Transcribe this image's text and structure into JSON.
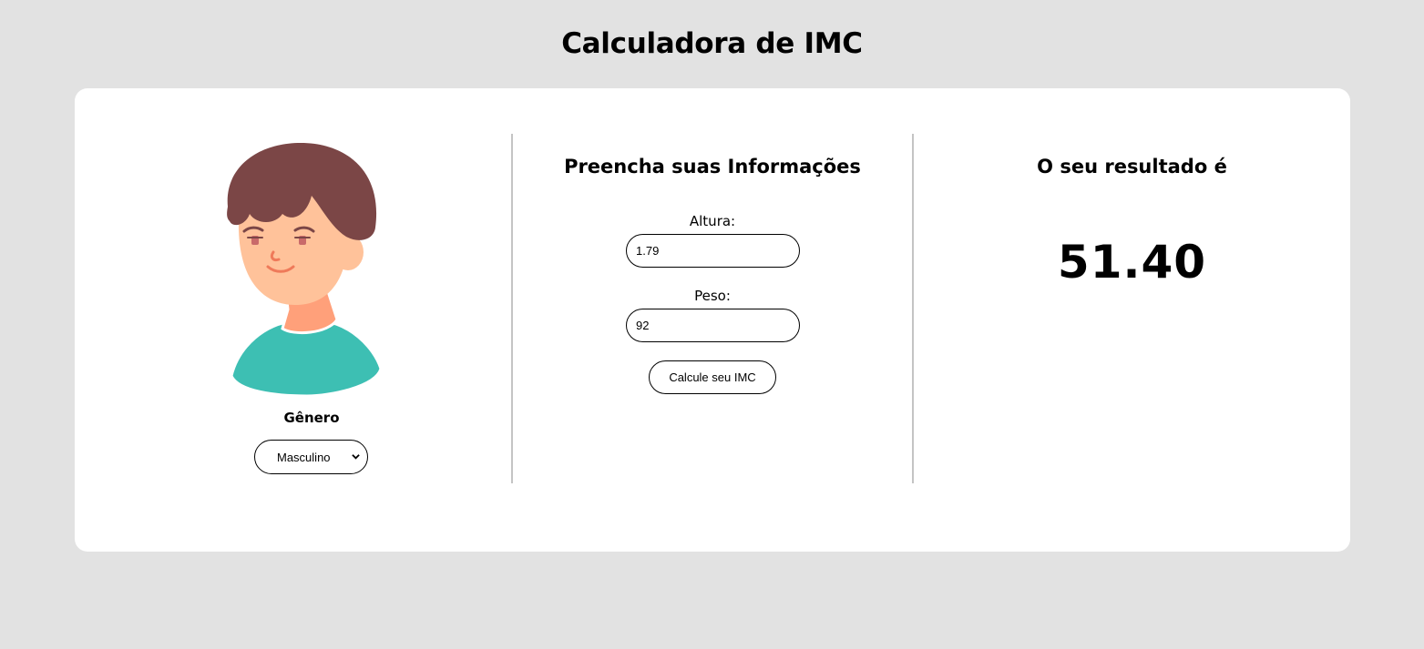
{
  "header": {
    "title": "Calculadora de IMC"
  },
  "left_panel": {
    "avatar_icon": "boy-avatar-illustration",
    "gender_label": "Gênero",
    "gender_select_value": "Masculino"
  },
  "middle_panel": {
    "title": "Preencha suas Informações",
    "height_label": "Altura:",
    "height_value": "1.79",
    "weight_label": "Peso:",
    "weight_value": "92",
    "calc_button_label": "Calcule seu IMC"
  },
  "right_panel": {
    "title": "O seu resultado é",
    "result_value": "51.40"
  },
  "colors": {
    "page_background": "#e2e2e2",
    "card_background": "#ffffff",
    "divider": "#c4c4c4",
    "hair": "#7b4646",
    "skin": "#ffc29a",
    "neck": "#ffa07a",
    "shirt": "#3dbfb3"
  }
}
